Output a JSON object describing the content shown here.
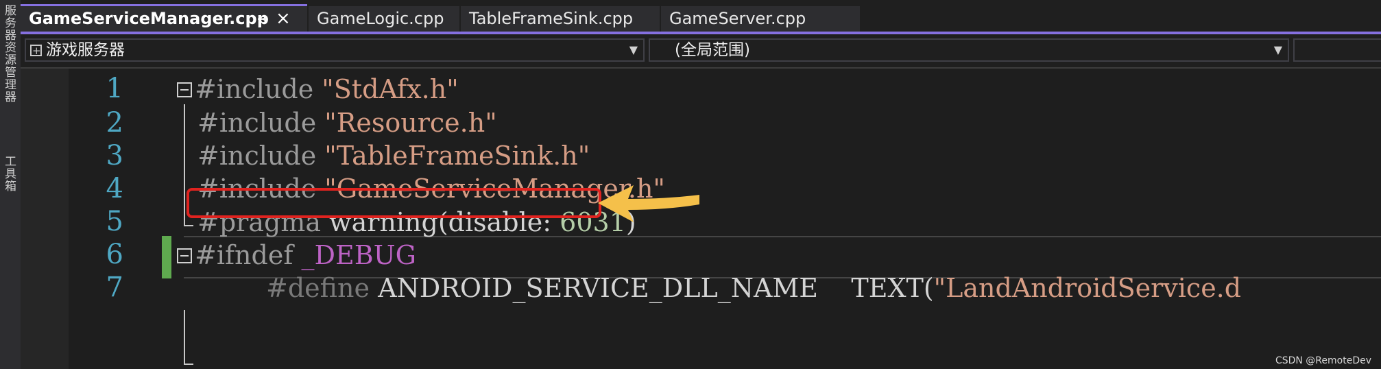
{
  "side_panel": {
    "label_top": "服务器资源管理器",
    "label_bottom": "工具箱"
  },
  "tabs": [
    {
      "label": "GameServiceManager.cpp",
      "active": true,
      "pin": "⊸",
      "close": "×"
    },
    {
      "label": "GameLogic.cpp",
      "active": false
    },
    {
      "label": "TableFrameSink.cpp",
      "active": false
    },
    {
      "label": "GameServer.cpp",
      "active": false
    }
  ],
  "nav": {
    "project": "游戏服务器",
    "scope": "(全局范围)"
  },
  "code": {
    "line_numbers": [
      "1",
      "2",
      "3",
      "4",
      "5",
      "6",
      "7"
    ],
    "lines": [
      {
        "directive": "#include",
        "string": "\"StdAfx.h\""
      },
      {
        "directive": "#include",
        "string": "\"Resource.h\""
      },
      {
        "directive": "#include",
        "string": "\"TableFrameSink.h\""
      },
      {
        "directive": "#include",
        "string": "\"GameServiceManager.h\""
      },
      {
        "directive": "#pragma",
        "text": " warning(disable: ",
        "number": "6031",
        "close": ")"
      },
      {
        "directive": "#ifndef",
        "macro": "_DEBUG"
      },
      {
        "directive": "#define",
        "text": "ANDROID_SERVICE_DLL_NAME    TEXT(",
        "string": "\"LandAndroidService.d"
      }
    ]
  },
  "annotation": {
    "highlighted_line": 5,
    "box_color": "#e0231f",
    "arrow_color": "#f5c04a"
  },
  "watermark": "CSDN @RemoteDev",
  "colors": {
    "accent": "#8570e0",
    "line_number": "#4fa8c4",
    "string": "#d69d85",
    "number": "#b5cea8",
    "macro": "#bd63c5"
  }
}
